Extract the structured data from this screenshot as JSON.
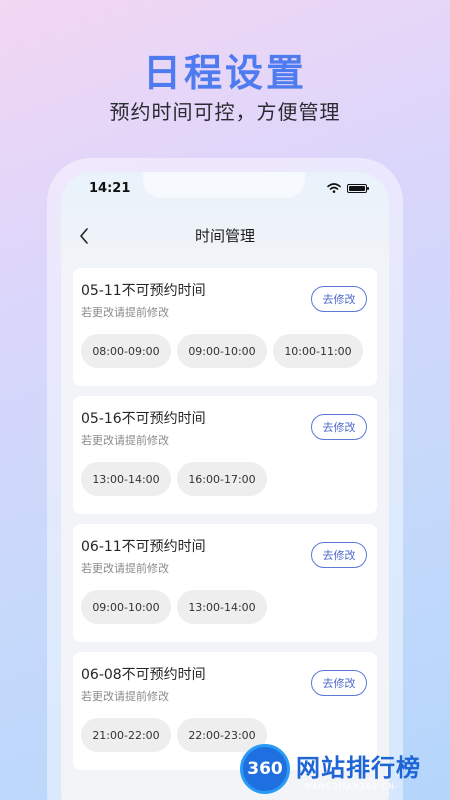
{
  "promo": {
    "headline": "日程设置",
    "subline": "预约时间可控，方便管理"
  },
  "status_bar": {
    "time": "14:21"
  },
  "nav": {
    "title": "时间管理",
    "back_icon": "chevron-left-icon"
  },
  "cards": [
    {
      "title": "05-11不可预约时间",
      "subtitle": "若更改请提前修改",
      "button_label": "去修改",
      "slots": [
        "08:00-09:00",
        "09:00-10:00",
        "10:00-11:00"
      ]
    },
    {
      "title": "05-16不可预约时间",
      "subtitle": "若更改请提前修改",
      "button_label": "去修改",
      "slots": [
        "13:00-14:00",
        "16:00-17:00"
      ]
    },
    {
      "title": "06-11不可预约时间",
      "subtitle": "若更改请提前修改",
      "button_label": "去修改",
      "slots": [
        "09:00-10:00",
        "13:00-14:00"
      ]
    },
    {
      "title": "06-08不可预约时间",
      "subtitle": "若更改请提前修改",
      "button_label": "去修改",
      "slots": [
        "21:00-22:00",
        "22:00-23:00"
      ]
    }
  ],
  "watermark": {
    "logo_text": "360",
    "text": "网站排行榜",
    "url": "-WANGZHAN360.CN-"
  },
  "colors": {
    "accent": "#4f7bf0",
    "button_border": "#5b79d6",
    "slot_bg": "#eeeeee"
  }
}
